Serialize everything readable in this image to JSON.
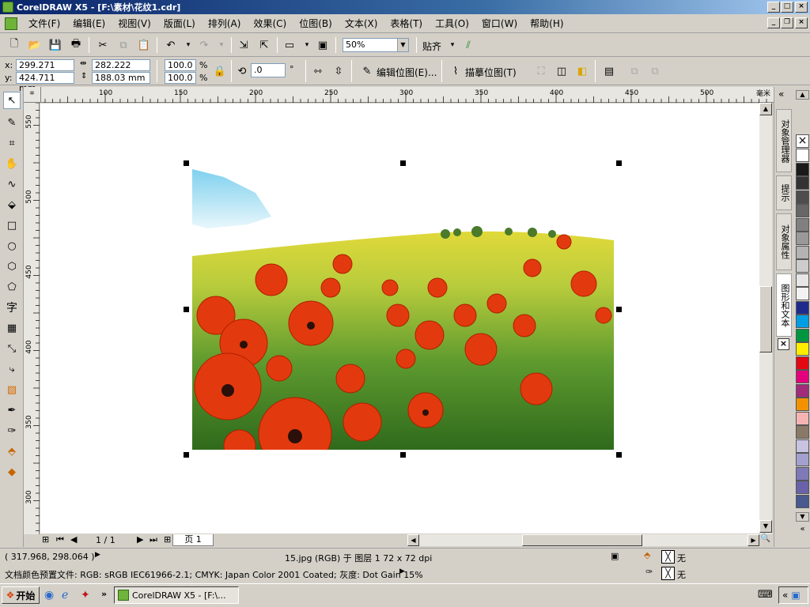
{
  "window": {
    "title": "CorelDRAW X5 - [F:\\素材\\花纹1.cdr]",
    "min": "_",
    "max": "□",
    "close": "×"
  },
  "menu": [
    "文件(F)",
    "编辑(E)",
    "视图(V)",
    "版面(L)",
    "排列(A)",
    "效果(C)",
    "位图(B)",
    "文本(X)",
    "表格(T)",
    "工具(O)",
    "窗口(W)",
    "帮助(H)"
  ],
  "toolbar": {
    "zoom": "50%",
    "snap_label": "贴齐"
  },
  "props": {
    "x_label": "x:",
    "x_value": "299.271 mm",
    "y_label": "y:",
    "y_value": "424.711 mm",
    "w_value": "282.222 mm",
    "h_value": "188.03 mm",
    "scale_w": "100.0",
    "scale_h": "100.0",
    "percent": "%",
    "angle": ".0",
    "degree": "°",
    "edit_bitmap": "编辑位图(E)...",
    "trace_bitmap": "描摹位图(T)"
  },
  "ruler": {
    "top_ticks": [
      "100",
      "150",
      "200",
      "250",
      "300",
      "350",
      "400",
      "450",
      "500"
    ],
    "unit": "毫米",
    "left_ticks": [
      "550",
      "500",
      "450",
      "400",
      "350",
      "300"
    ]
  },
  "pagenav": {
    "current": "1 / 1",
    "tab": "页 1"
  },
  "dockers": {
    "tabs": [
      "对象管理器",
      "提示",
      "对象属性",
      "图形和文本"
    ]
  },
  "palette": {
    "colors": [
      "#ffffff",
      "#1a1a1a",
      "#333333",
      "#4d4d4d",
      "#666666",
      "#808080",
      "#999999",
      "#b3b3b3",
      "#cccccc",
      "#e6e6e6",
      "#f2f2f2",
      "#1f2b8c",
      "#009fe3",
      "#00963f",
      "#ffed00",
      "#e30613",
      "#e4007c",
      "#a02c7a",
      "#f39200",
      "#f5b4b3",
      "#8a7966",
      "#c8c3e0",
      "#a3a0cf",
      "#7e7ab8",
      "#6a62a8",
      "#4a5a8f"
    ]
  },
  "status": {
    "coords": "( 317.968, 298.064 )",
    "object_info": "15.jpg (RGB) 于 图层 1 72 x 72 dpi",
    "fill_label": "无",
    "outline_label": "无",
    "color_profile": "文档颜色预置文件: RGB: sRGB IEC61966-2.1; CMYK: Japan Color 2001 Coated; 灰度: Dot Gain 15%"
  },
  "taskbar": {
    "start": "开始",
    "task": "CorelDRAW X5 - [F:\\...",
    "more": "»"
  }
}
